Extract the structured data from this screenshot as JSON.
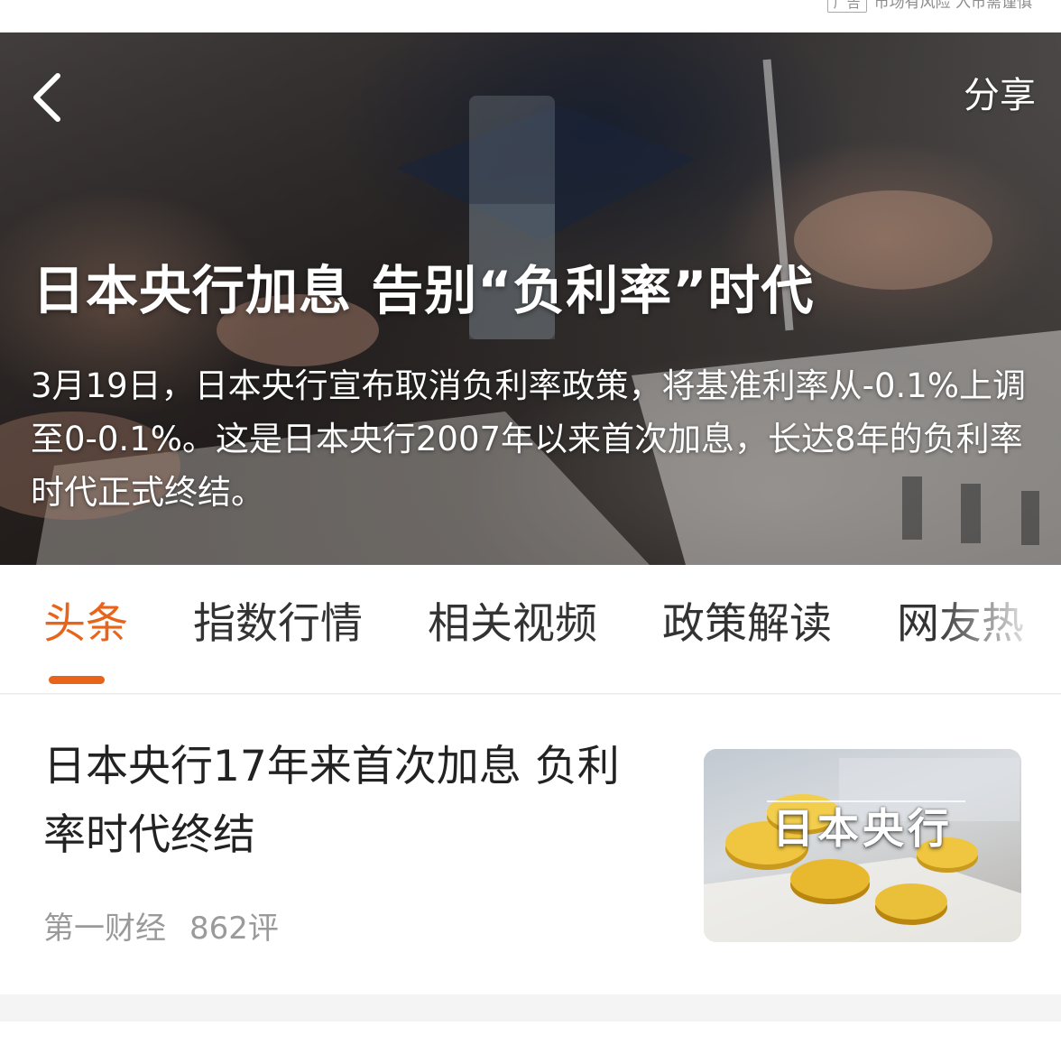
{
  "ad": {
    "badge": "广告",
    "disclaimer": "市场有风险 入市需谨慎"
  },
  "nav": {
    "back_icon": "chevron-left-icon",
    "share_label": "分享"
  },
  "hero": {
    "title": "日本央行加息 告别“负利率”时代",
    "summary": "3月19日，日本央行宣布取消负利率政策，将基准利率从-0.1%上调至0-0.1%。这是日本央行2007年以来首次加息，长达8年的负利率时代正式终结。"
  },
  "tabs": [
    {
      "label": "头条",
      "active": true
    },
    {
      "label": "指数行情",
      "active": false
    },
    {
      "label": "相关视频",
      "active": false
    },
    {
      "label": "政策解读",
      "active": false
    },
    {
      "label": "网友热",
      "active": false
    }
  ],
  "colors": {
    "accent": "#e8641b",
    "text_primary": "#222222",
    "text_secondary": "#9a9a9a"
  },
  "article": {
    "title": "日本央行17年来首次加息 负利率时代终结",
    "source": "第一财经",
    "comments": "862评",
    "thumbnail_caption": "日本央行"
  }
}
